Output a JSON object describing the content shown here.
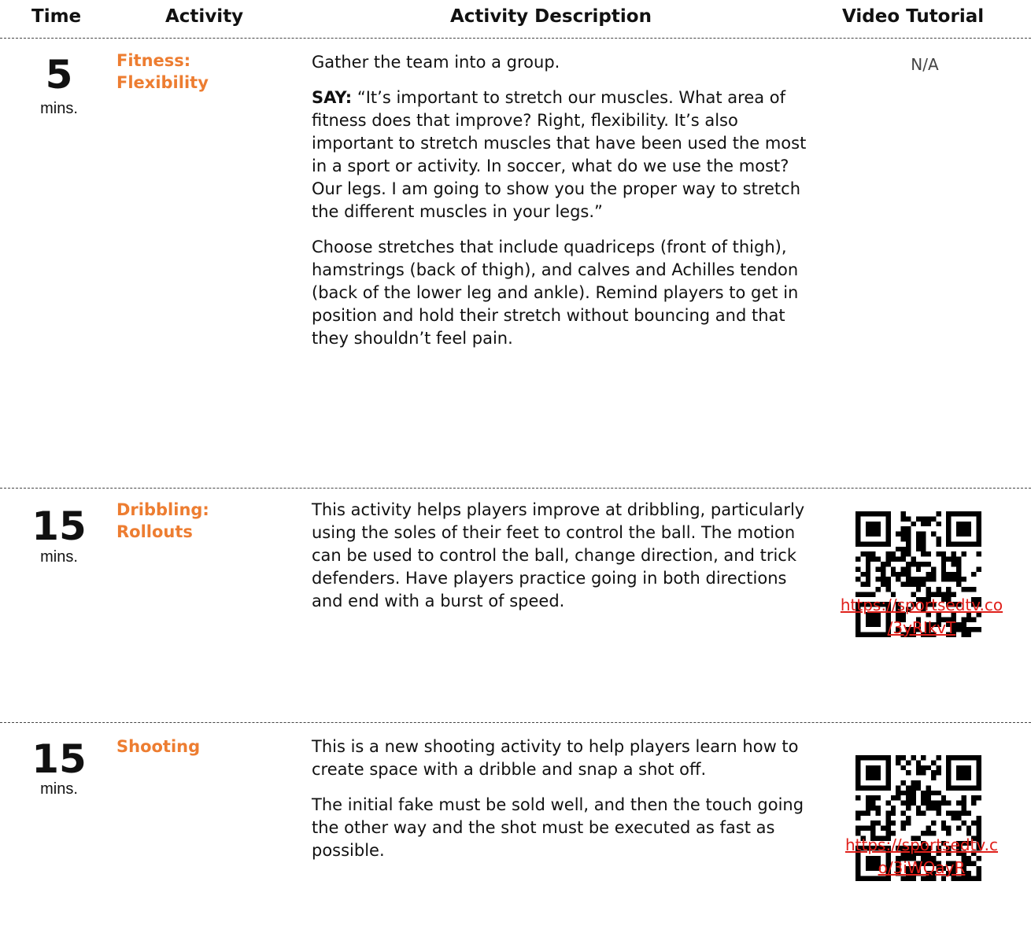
{
  "headers": {
    "time": "Time",
    "activity": "Activity",
    "description": "Activity Description",
    "video": "Video Tutorial"
  },
  "rows": [
    {
      "time": "5",
      "unit": "mins.",
      "activity": [
        "Fitness:",
        "Flexibility"
      ],
      "p1": "Gather the team into a group.",
      "say_label": "SAY:",
      "say_text": "“It’s important to stretch our muscles. What area of fitness does that improve? Right, flexibility. It’s also important to stretch muscles that have been used the most in a sport or activity. In soccer, what do we use the most? Our legs. I am going to show you the proper way to stretch the different muscles in your legs.”",
      "p3": "Choose stretches that include quadriceps (front of thigh), hamstrings (back of thigh), and calves and Achilles tendon (back of the lower leg and ankle). Remind players to get in position and hold their stretch without bouncing and that they shouldn’t feel pain.",
      "video": "N/A"
    },
    {
      "time": "15",
      "unit": "mins.",
      "activity": [
        "Dribbling:",
        "Rollouts"
      ],
      "p1": "This activity helps players improve at dribbling, particularly using the soles of their feet to control the ball. The motion can be used to control the ball, change direction, and trick defenders. Have players practice going in both directions and end with a burst of speed.",
      "link": [
        "https://sportsedtv.co",
        "/3yRIkvT"
      ]
    },
    {
      "time": "15",
      "unit": "mins.",
      "activity": [
        "Shooting"
      ],
      "p1": "This is a new shooting activity to help players learn how to create space with a dribble and snap a shot off.",
      "p2": "The initial fake must be sold well, and then the touch going the other way and the shot must be executed as fast as possible.",
      "link": [
        "https://sportsedtv.c",
        "o/3iWQayR"
      ]
    }
  ],
  "colors": {
    "activity": "#ed7d31",
    "link": "#e0201b"
  },
  "icons": [
    "qr-code-icon"
  ]
}
